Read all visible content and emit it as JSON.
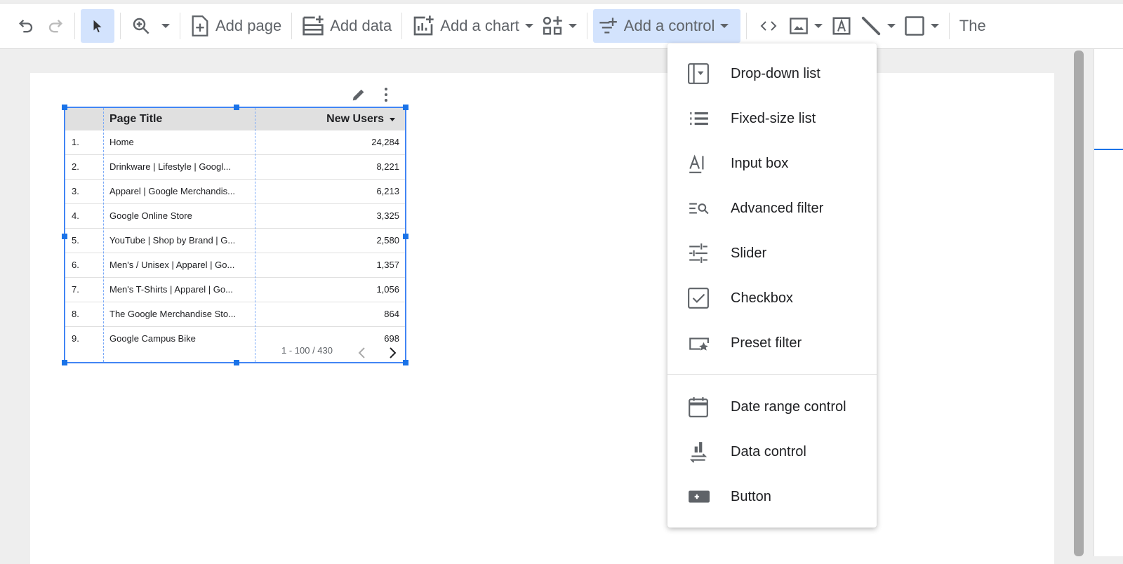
{
  "toolbar": {
    "add_page": "Add page",
    "add_data": "Add data",
    "add_chart": "Add a chart",
    "add_control": "Add a control",
    "theme": "The"
  },
  "table": {
    "headers": [
      "Page Title",
      "New Users"
    ],
    "rows": [
      {
        "n": "1.",
        "title": "Home",
        "value": "24,284"
      },
      {
        "n": "2.",
        "title": "Drinkware | Lifestyle | Googl...",
        "value": "8,221"
      },
      {
        "n": "3.",
        "title": "Apparel | Google Merchandis...",
        "value": "6,213"
      },
      {
        "n": "4.",
        "title": "Google Online Store",
        "value": "3,325"
      },
      {
        "n": "5.",
        "title": "YouTube | Shop by Brand | G...",
        "value": "2,580"
      },
      {
        "n": "6.",
        "title": "Men's / Unisex | Apparel | Go...",
        "value": "1,357"
      },
      {
        "n": "7.",
        "title": "Men's T-Shirts | Apparel | Go...",
        "value": "1,056"
      },
      {
        "n": "8.",
        "title": "The Google Merchandise Sto...",
        "value": "864"
      },
      {
        "n": "9.",
        "title": "Google Campus Bike",
        "value": "698"
      }
    ],
    "pagination": "1 - 100 / 430"
  },
  "menu": {
    "items": [
      {
        "label": "Drop-down list",
        "icon": "dropdown-list-icon"
      },
      {
        "label": "Fixed-size list",
        "icon": "list-icon"
      },
      {
        "label": "Input box",
        "icon": "input-box-icon"
      },
      {
        "label": "Advanced filter",
        "icon": "advanced-filter-icon"
      },
      {
        "label": "Slider",
        "icon": "slider-icon"
      },
      {
        "label": "Checkbox",
        "icon": "checkbox-icon"
      },
      {
        "label": "Preset filter",
        "icon": "preset-filter-icon"
      },
      {
        "label": "Date range control",
        "icon": "calendar-icon"
      },
      {
        "label": "Data control",
        "icon": "data-control-icon"
      },
      {
        "label": "Button",
        "icon": "button-icon"
      }
    ]
  },
  "colors": {
    "accent": "#1a73e8",
    "selected_bg": "#d3e3fd"
  }
}
